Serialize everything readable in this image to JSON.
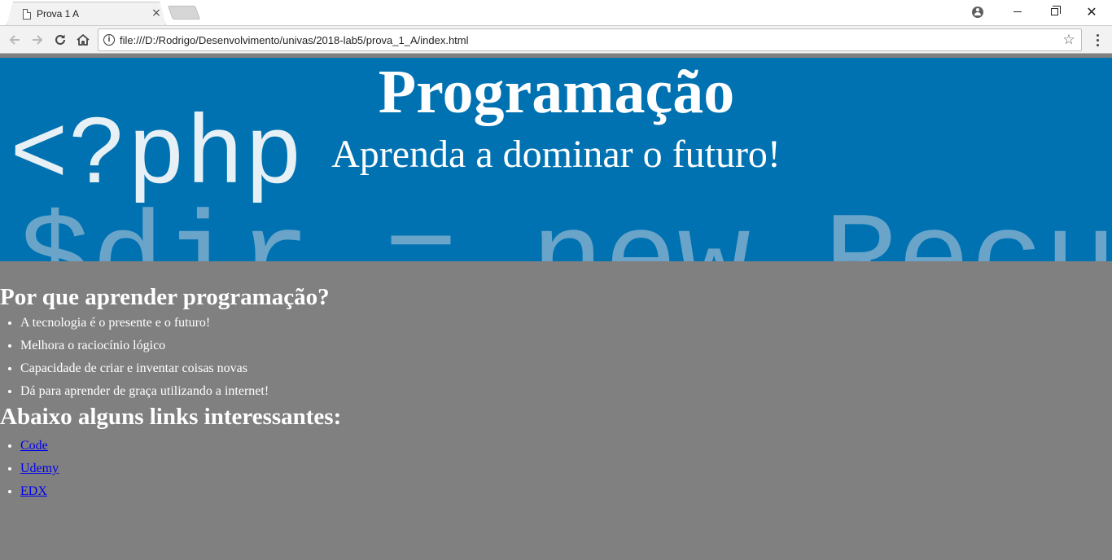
{
  "browser": {
    "tab_title": "Prova 1 A",
    "tab_close": "×",
    "url": "file:///D:/Rodrigo/Desenvolvimento/univas/2018-lab5/prova_1_A/index.html",
    "info_glyph": "i",
    "star_glyph": "☆",
    "close_glyph": "✕"
  },
  "banner": {
    "title": "Programação",
    "subtitle": "Aprenda a dominar o futuro!",
    "bg_code_1": "<?php",
    "bg_code_2": "$dir = new Recurs",
    "background_color": "#0072b1"
  },
  "section_why": {
    "heading": "Por que aprender programação?",
    "items": [
      "A tecnologia é o presente e o futuro!",
      "Melhora o raciocínio lógico",
      "Capacidade de criar e inventar coisas novas",
      "Dá para aprender de graça utilizando a internet!"
    ]
  },
  "section_links": {
    "heading": "Abaixo alguns links interessantes:",
    "links": [
      "Code",
      "Udemy",
      "EDX"
    ]
  },
  "colors": {
    "page_background": "#808080",
    "text": "#ffffff",
    "link": "#0000ee"
  }
}
